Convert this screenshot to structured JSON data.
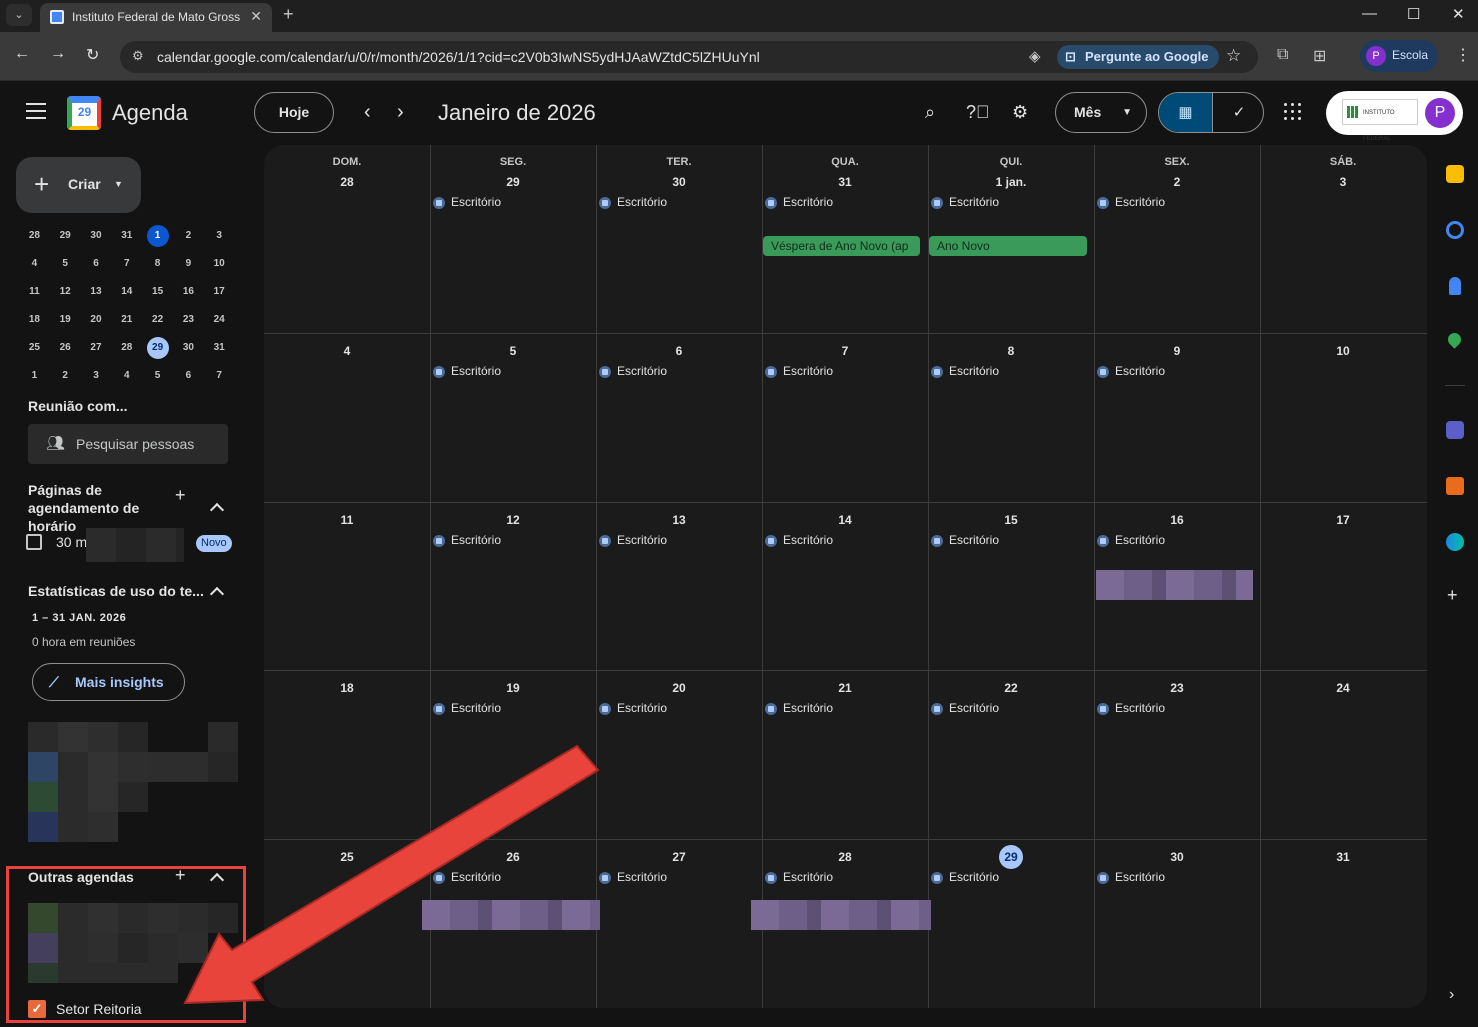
{
  "browser": {
    "tab_title": "Instituto Federal de Mato Grosso",
    "url": "calendar.google.com/calendar/u/0/r/month/2026/1/1?cid=c2V0b3IwNS5ydHJAaWZtdC5lZHUuYnl",
    "ask_google": "Pergunte ao Google",
    "profile_initial": "P",
    "profile_label": "Escola"
  },
  "header": {
    "app_name": "Agenda",
    "logo_day": "29",
    "today_label": "Hoje",
    "period_title": "Janeiro de 2026",
    "view_label": "Mês",
    "org_logo_text": "INSTITUTO FEDERAL",
    "avatar_initial": "P"
  },
  "sidebar": {
    "create_label": "Criar",
    "mini_calendar": [
      [
        "28",
        "29",
        "30",
        "31",
        "1",
        "2",
        "3"
      ],
      [
        "4",
        "5",
        "6",
        "7",
        "8",
        "9",
        "10"
      ],
      [
        "11",
        "12",
        "13",
        "14",
        "15",
        "16",
        "17"
      ],
      [
        "18",
        "19",
        "20",
        "21",
        "22",
        "23",
        "24"
      ],
      [
        "25",
        "26",
        "27",
        "28",
        "29",
        "30",
        "31"
      ],
      [
        "1",
        "2",
        "3",
        "4",
        "5",
        "6",
        "7"
      ]
    ],
    "meet_with": "Reunião com...",
    "search_people": "Pesquisar pessoas",
    "booking_title": "Páginas de agendamento de horário",
    "booking_item": "30 m",
    "booking_badge": "Novo",
    "stats_title": "Estatísticas de uso do te...",
    "stats_range": "1 – 31 JAN. 2026",
    "stats_meetings": "0 hora em reuniões",
    "insights_label": "Mais insights",
    "other_calendars": "Outras agendas",
    "calendar_item": "Setor Reitoria"
  },
  "grid": {
    "weekdays": [
      "DOM.",
      "SEG.",
      "TER.",
      "QUA.",
      "QUI.",
      "SEX.",
      "SÁB."
    ],
    "weeks": [
      [
        "28",
        "29",
        "30",
        "31",
        "1 jan.",
        "2",
        "3"
      ],
      [
        "4",
        "5",
        "6",
        "7",
        "8",
        "9",
        "10"
      ],
      [
        "11",
        "12",
        "13",
        "14",
        "15",
        "16",
        "17"
      ],
      [
        "18",
        "19",
        "20",
        "21",
        "22",
        "23",
        "24"
      ],
      [
        "25",
        "26",
        "27",
        "28",
        "29",
        "30",
        "31"
      ]
    ],
    "office_label": "Escritório",
    "holiday_eve": "Véspera de Ano Novo (ap",
    "holiday_new_year": "Ano Novo",
    "today_color": "#a8c7fa",
    "holiday_color": "#3a9a5a"
  }
}
